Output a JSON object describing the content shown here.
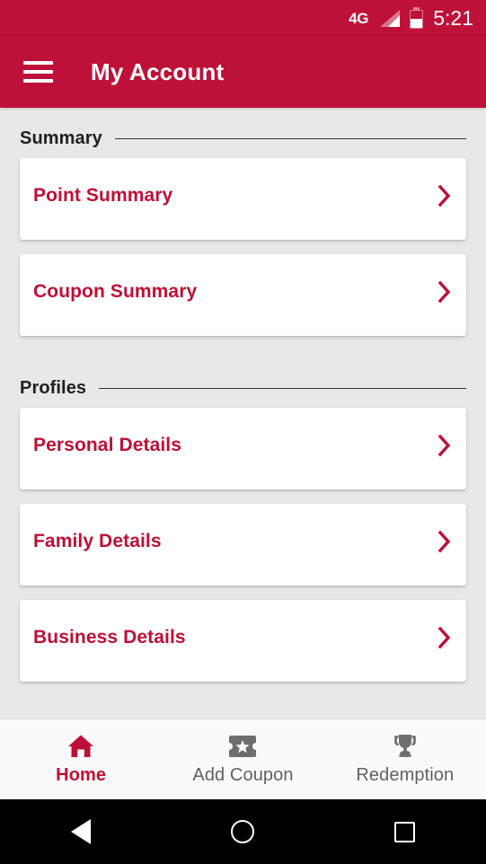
{
  "status_bar": {
    "network": "4G",
    "time": "5:21",
    "signal_icon": "signal-bars-icon",
    "battery_icon": "battery-icon"
  },
  "app_bar": {
    "menu_icon": "hamburger-menu-icon",
    "title": "My Account"
  },
  "colors": {
    "brand_red": "#BE1139",
    "text_red": "#BE0F36",
    "page_bg": "#E8E8E8",
    "card_bg": "#FFFFFF",
    "nav_bg": "#FAFAFA",
    "nav_inactive": "#616161"
  },
  "sections": [
    {
      "title": "Summary",
      "items": [
        {
          "label": "Point Summary",
          "chevron_icon": "chevron-right-icon"
        },
        {
          "label": "Coupon Summary",
          "chevron_icon": "chevron-right-icon"
        }
      ]
    },
    {
      "title": "Profiles",
      "items": [
        {
          "label": "Personal Details",
          "chevron_icon": "chevron-right-icon"
        },
        {
          "label": "Family Details",
          "chevron_icon": "chevron-right-icon"
        },
        {
          "label": "Business Details",
          "chevron_icon": "chevron-right-icon"
        }
      ]
    }
  ],
  "bottom_nav": {
    "items": [
      {
        "label": "Home",
        "icon": "home-icon",
        "active": true
      },
      {
        "label": "Add Coupon",
        "icon": "ticket-star-icon",
        "active": false
      },
      {
        "label": "Redemption",
        "icon": "trophy-icon",
        "active": false
      }
    ]
  },
  "system_nav": {
    "back": "back-triangle-icon",
    "home": "home-circle-icon",
    "recents": "recents-square-icon"
  }
}
